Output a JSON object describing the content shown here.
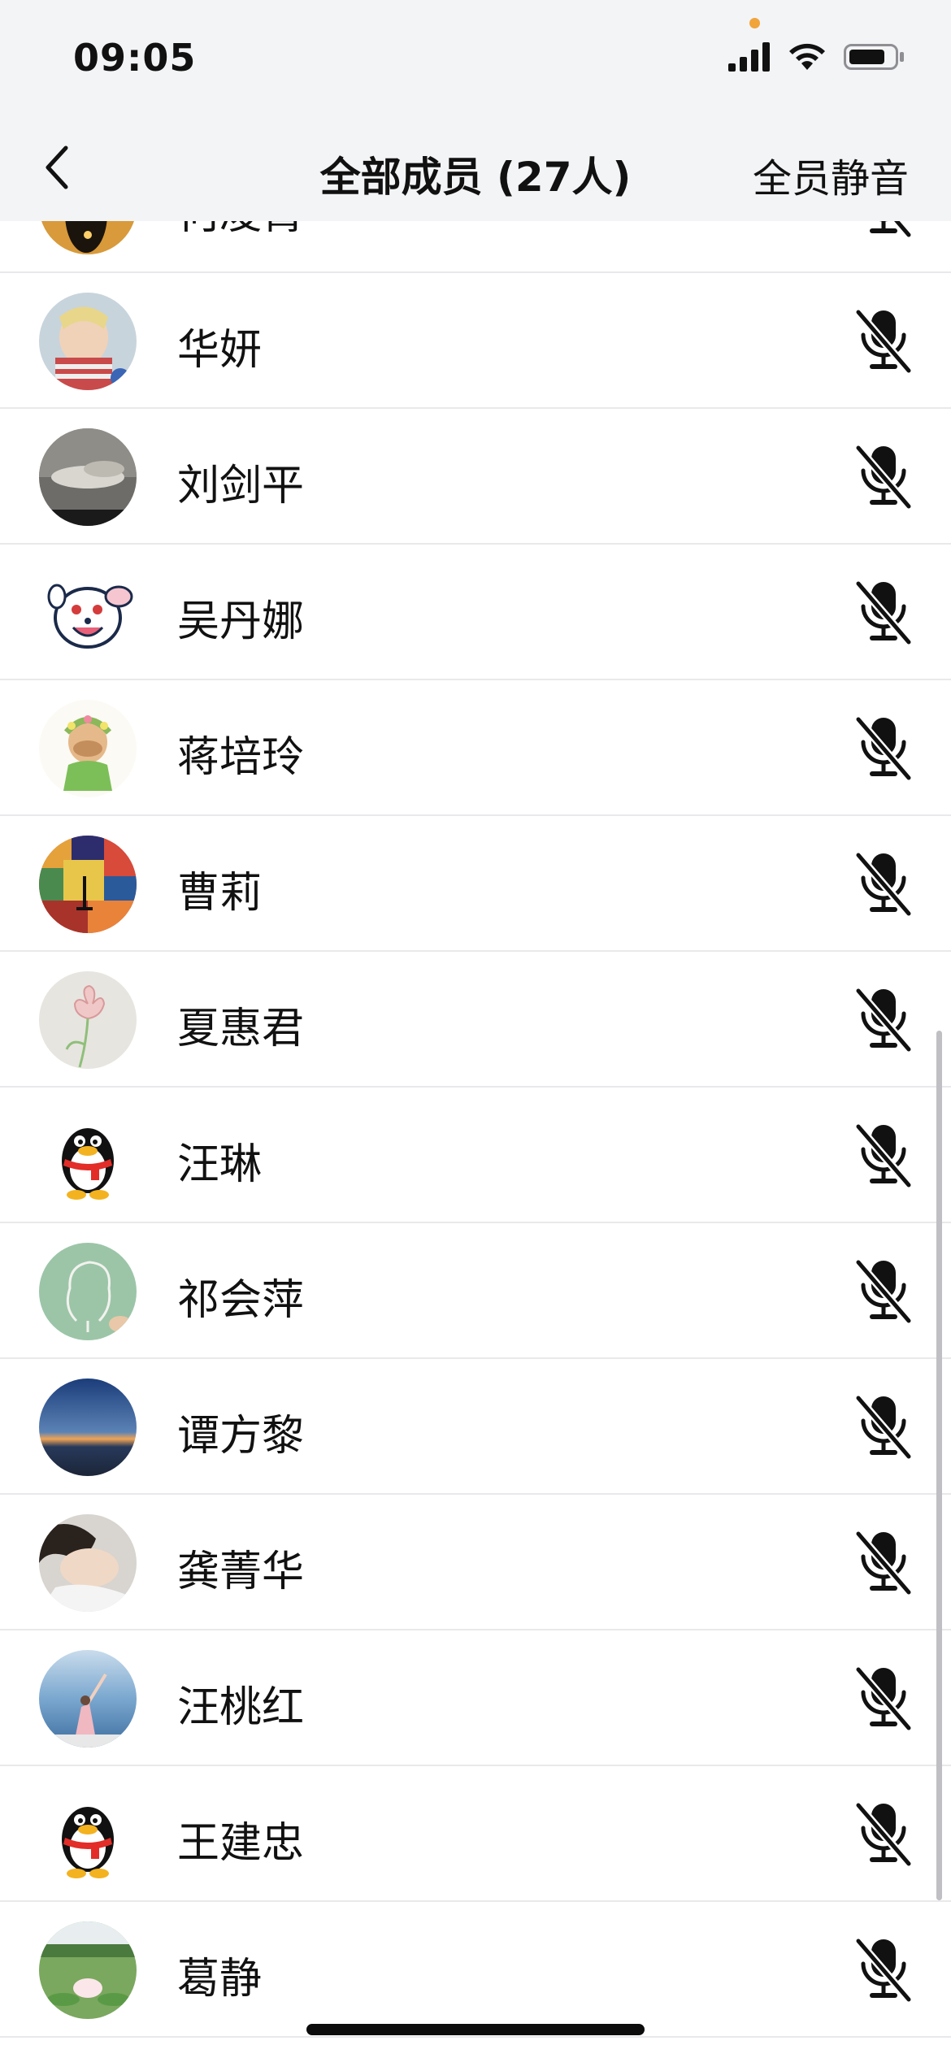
{
  "status_bar": {
    "time": "09:05"
  },
  "nav": {
    "title": "全部成员 (27人)",
    "mute_all": "全员静音"
  },
  "members": [
    {
      "name": "何凌霄",
      "avatar": "bird-silhouette-sunset"
    },
    {
      "name": "华妍",
      "avatar": "child-photo"
    },
    {
      "name": "刘剑平",
      "avatar": "cloudy-sky"
    },
    {
      "name": "吴丹娜",
      "avatar": "cartoon-dog"
    },
    {
      "name": "蒋培玲",
      "avatar": "doll-with-flowers"
    },
    {
      "name": "曹莉",
      "avatar": "colorful-mosaic"
    },
    {
      "name": "夏惠君",
      "avatar": "tulip-drawing"
    },
    {
      "name": "汪琳",
      "avatar": "qq-penguin"
    },
    {
      "name": "祁会萍",
      "avatar": "chalk-head-drawing"
    },
    {
      "name": "谭方黎",
      "avatar": "sunset-horizon"
    },
    {
      "name": "龚菁华",
      "avatar": "sleeping-person"
    },
    {
      "name": "汪桃红",
      "avatar": "person-by-lake"
    },
    {
      "name": "王建忠",
      "avatar": "qq-penguin"
    },
    {
      "name": "葛静",
      "avatar": "lotus-pond"
    }
  ],
  "icons": {
    "mute_icon": "microphone-muted-icon",
    "back_icon": "chevron-left-icon"
  }
}
